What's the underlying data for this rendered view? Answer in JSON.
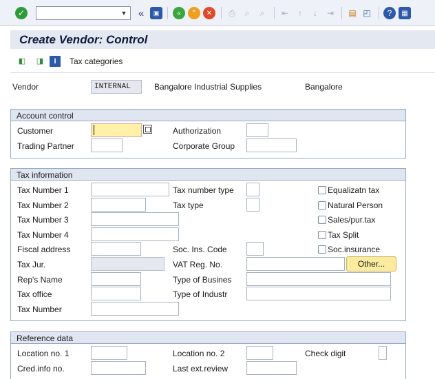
{
  "toolbar": {
    "back_label": "«"
  },
  "title": "Create Vendor: Control",
  "app_toolbar": {
    "tax_categories": "Tax categories"
  },
  "vendor": {
    "label": "Vendor",
    "value": "INTERNAL",
    "name": "Bangalore Industrial Supplies",
    "city": "Bangalore"
  },
  "account_control": {
    "title": "Account control",
    "customer": "Customer",
    "authorization": "Authorization",
    "trading_partner": "Trading Partner",
    "corporate_group": "Corporate Group"
  },
  "tax_information": {
    "title": "Tax information",
    "tax_number_1": "Tax Number 1",
    "tax_number_2": "Tax Number 2",
    "tax_number_3": "Tax Number 3",
    "tax_number_4": "Tax Number 4",
    "fiscal_address": "Fiscal address",
    "tax_jur": "Tax Jur.",
    "reps_name": "Rep's Name",
    "tax_office": "Tax office",
    "tax_number": "Tax Number",
    "tax_number_type": "Tax number type",
    "tax_type": "Tax type",
    "soc_ins_code": "Soc. Ins. Code",
    "vat_reg_no": "VAT Reg. No.",
    "type_of_business": "Type of Busines",
    "type_of_industry": "Type of Industr",
    "other_button": "Other...",
    "equalization_tax": "Equalizatn tax",
    "natural_person": "Natural Person",
    "sales_pur_tax": "Sales/pur.tax",
    "tax_split": "Tax Split",
    "soc_insurance": "Soc.insurance"
  },
  "reference_data": {
    "title": "Reference data",
    "location_no_1": "Location no. 1",
    "location_no_2": "Location no. 2",
    "check_digit": "Check digit",
    "cred_info_no": "Cred.info no.",
    "last_ext_review": "Last ext.review"
  }
}
